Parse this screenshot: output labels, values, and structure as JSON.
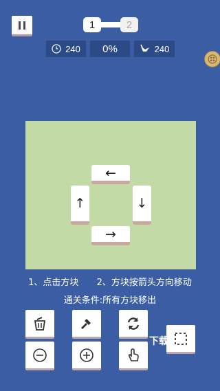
{
  "level": {
    "current": "1",
    "next": "2"
  },
  "stats": {
    "time": "240",
    "progress": "0%",
    "moves": "240"
  },
  "tiles": {
    "up_left": "←",
    "left": "↑",
    "right": "↓",
    "bottom": "→"
  },
  "instructions": {
    "step1": "1、点击方块",
    "step2": "2、方块按箭头方向移动",
    "goal": "通关条件:所有方块移出"
  },
  "overlay": {
    "text": "下载"
  },
  "colors": {
    "background": "#3a5da4",
    "board": "#c2dba6",
    "stat_bg": "#2c4a86"
  },
  "icons": [
    "pause-icon",
    "clock-icon",
    "bird-icon",
    "coin-icon",
    "trash-icon",
    "hammer-icon",
    "refresh-icon",
    "select-icon",
    "zoom-out-icon",
    "zoom-in-icon",
    "hand-icon"
  ]
}
